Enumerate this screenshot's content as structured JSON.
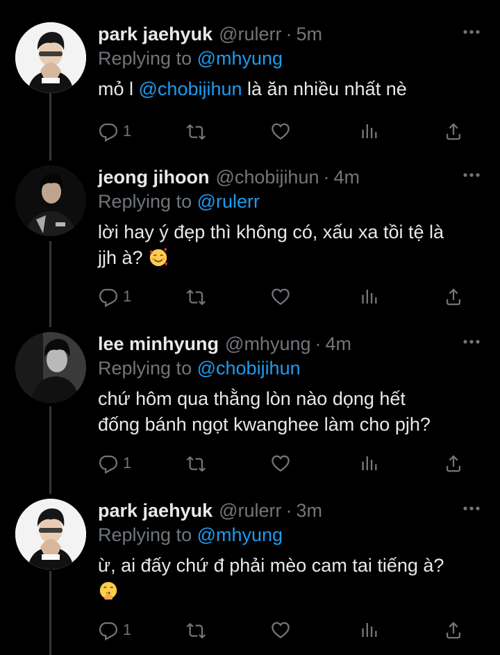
{
  "tweets": [
    {
      "name": "park jaehyuk",
      "handle": "@rulerr",
      "time": "5m",
      "replying_prefix": "Replying to",
      "replying_to": "@mhyung",
      "text_parts": [
        "mỏ l ",
        "@chobijihun",
        " là ăn nhiều nhất nè"
      ],
      "text_line2": "",
      "reply_count": "1",
      "avatar_icon": "user-avatar-light"
    },
    {
      "name": "jeong jihoon",
      "handle": "@chobijihun",
      "time": "4m",
      "replying_prefix": "Replying to",
      "replying_to": "@rulerr",
      "text_line1": "lời hay ý đẹp thì không có, xấu xa tồi tệ là",
      "text_line2": "jjh à?",
      "emoji": "smiling-face-with-hearts-emoji",
      "reply_count": "1",
      "avatar_icon": "user-avatar-dark"
    },
    {
      "name": "lee minhyung",
      "handle": "@mhyung",
      "time": "4m",
      "replying_prefix": "Replying to",
      "replying_to": "@chobijihun",
      "text_line1": "chứ hôm qua thằng lòn nào dọng hết",
      "text_line2": "đống bánh ngọt kwanghee làm cho pjh?",
      "reply_count": "1",
      "avatar_icon": "user-avatar-grey"
    },
    {
      "name": "park jaehyuk",
      "handle": "@rulerr",
      "time": "3m",
      "replying_prefix": "Replying to",
      "replying_to": "@mhyung",
      "text_line1": "ừ, ai đấy chứ đ phải mèo cam tai tiếng à?",
      "emoji": "shushing-face-emoji",
      "reply_count": "1",
      "avatar_icon": "user-avatar-light"
    }
  ],
  "dot_separator": "·",
  "colors": {
    "background": "#000000",
    "text": "#e7e9ea",
    "muted": "#71767b",
    "accent": "#1d9bf0",
    "thread_line": "#333639"
  }
}
